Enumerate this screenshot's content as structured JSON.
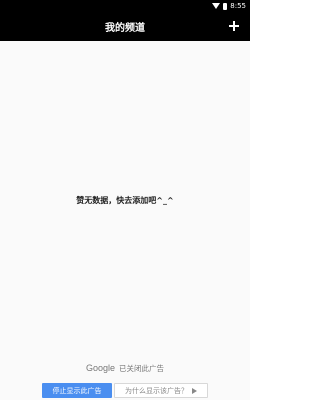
{
  "status_bar": {
    "time": "8:55",
    "wifi_icon": "wifi-icon",
    "battery_icon": "battery-icon"
  },
  "app_bar": {
    "title": "我的频道",
    "add_icon": "plus-icon",
    "background": "#000000",
    "foreground": "#ffffff"
  },
  "content": {
    "empty_message": "赞无数据，快去添加吧^_^"
  },
  "ad": {
    "brand": "Google",
    "closed_text": "已关闭此广告",
    "stop_label": "停止显示此广告",
    "why_label": "为什么显示该广告？",
    "adchoices_icon": "adchoices-icon",
    "accent": "#4a8ef0"
  }
}
